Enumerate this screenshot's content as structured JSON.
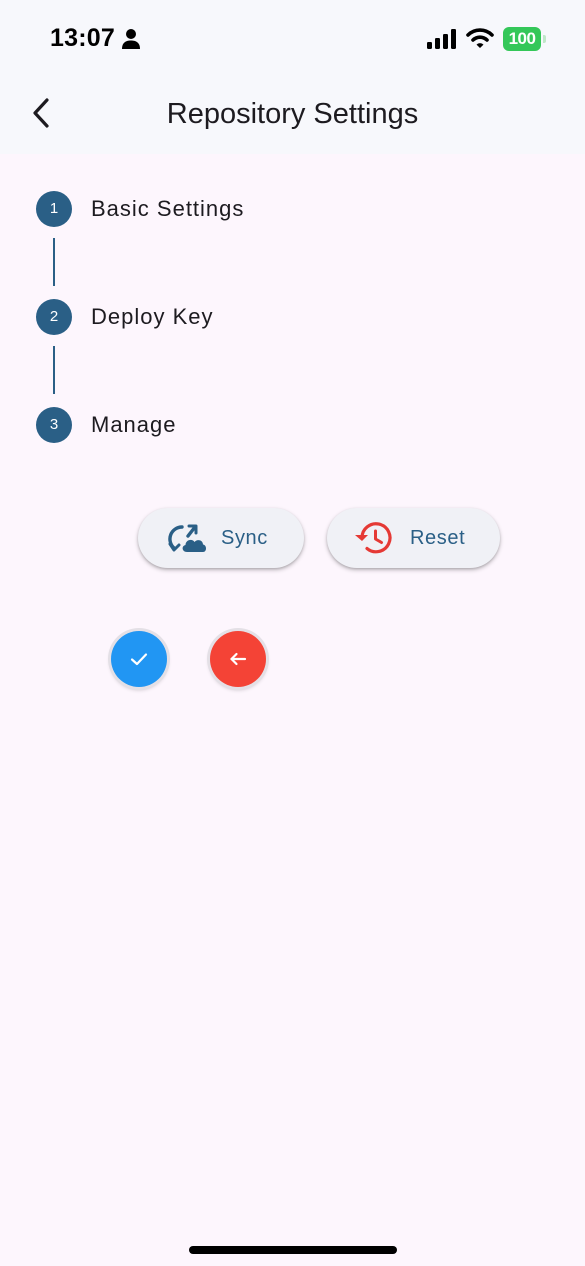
{
  "status_bar": {
    "time": "13:07",
    "battery": "100",
    "icons": [
      "person-icon",
      "signal-icon",
      "wifi-icon",
      "battery-icon"
    ]
  },
  "app_bar": {
    "title": "Repository Settings",
    "back_icon": "chevron-left-icon"
  },
  "stepper": {
    "steps": [
      {
        "number": "1",
        "label": "Basic Settings"
      },
      {
        "number": "2",
        "label": "Deploy Key"
      },
      {
        "number": "3",
        "label": "Manage"
      }
    ]
  },
  "actions": {
    "sync_label": "Sync",
    "sync_icon": "cloud-sync-icon",
    "reset_label": "Reset",
    "reset_icon": "history-icon"
  },
  "fabs": {
    "confirm_icon": "check-icon",
    "back_icon": "arrow-left-icon"
  },
  "colors": {
    "primary": "#2a5f86",
    "confirm": "#2196f3",
    "back": "#f44336",
    "reset_icon": "#e53935",
    "background": "#fdf6fd",
    "battery": "#34c759"
  }
}
